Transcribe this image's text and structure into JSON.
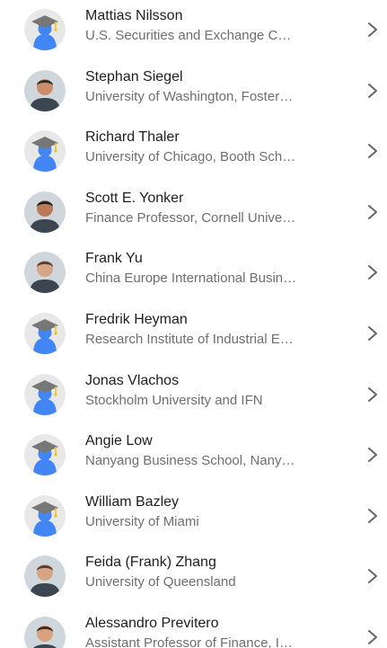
{
  "profiles": [
    {
      "name": "Mattias Nilsson",
      "affiliation": "U.S. Securities and Exchange C…",
      "avatar": "scholar-cap-placeholder"
    },
    {
      "name": "Stephan Siegel",
      "affiliation": "University of Washington, Foster…",
      "avatar": "photo"
    },
    {
      "name": "Richard Thaler",
      "affiliation": "University of Chicago, Booth Sch…",
      "avatar": "scholar-cap-placeholder"
    },
    {
      "name": "Scott E. Yonker",
      "affiliation": "Finance Professor, Cornell Unive…",
      "avatar": "photo"
    },
    {
      "name": "Frank Yu",
      "affiliation": "China Europe International Busin…",
      "avatar": "photo"
    },
    {
      "name": "Fredrik Heyman",
      "affiliation": "Research Institute of Industrial E…",
      "avatar": "scholar-cap-placeholder"
    },
    {
      "name": "Jonas Vlachos",
      "affiliation": "Stockholm University and IFN",
      "avatar": "scholar-cap-placeholder"
    },
    {
      "name": "Angie Low",
      "affiliation": "Nanyang Business School, Nany…",
      "avatar": "scholar-cap-placeholder"
    },
    {
      "name": "William Bazley",
      "affiliation": "University of Miami",
      "avatar": "scholar-cap-placeholder"
    },
    {
      "name": "Feida (Frank) Zhang",
      "affiliation": "University of Queensland",
      "avatar": "photo"
    },
    {
      "name": "Alessandro Previtero",
      "affiliation": "Assistant Professor of Finance, I…",
      "avatar": "photo"
    }
  ],
  "colors": {
    "name_text": "#1f1f1f",
    "affiliation_text": "#6f6f6f",
    "placeholder_bg": "#e8e8e8",
    "placeholder_figure": "#4285f4",
    "placeholder_cap": "#777777",
    "chevron": "#666666"
  }
}
